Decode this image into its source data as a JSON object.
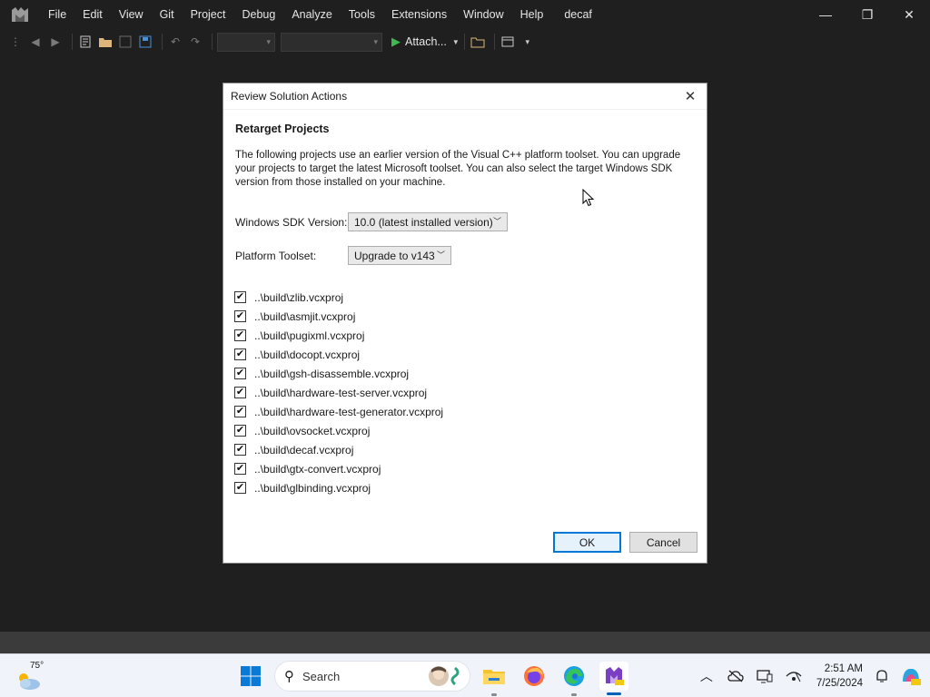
{
  "app": {
    "solution_name": "decaf",
    "menu": [
      "File",
      "Edit",
      "View",
      "Git",
      "Project",
      "Debug",
      "Analyze",
      "Tools",
      "Extensions",
      "Window",
      "Help"
    ],
    "toolbar": {
      "attach_label": "Attach..."
    },
    "window_controls": {
      "minimize": "—",
      "restore": "❐",
      "close": "✕"
    }
  },
  "dialog": {
    "title": "Review Solution Actions",
    "close_glyph": "✕",
    "heading": "Retarget Projects",
    "description": "The following projects use an earlier version of the Visual C++ platform toolset.  You can upgrade your projects to target the latest Microsoft toolset.  You can also select the target Windows SDK version from those installed on your machine.",
    "sdk": {
      "label": "Windows SDK Version:",
      "value": "10.0 (latest installed version)"
    },
    "toolset": {
      "label": "Platform Toolset:",
      "value": "Upgrade to v143"
    },
    "projects": [
      {
        "name": "..\\build\\zlib.vcxproj",
        "checked": true
      },
      {
        "name": "..\\build\\asmjit.vcxproj",
        "checked": true
      },
      {
        "name": "..\\build\\pugixml.vcxproj",
        "checked": true
      },
      {
        "name": "..\\build\\docopt.vcxproj",
        "checked": true
      },
      {
        "name": "..\\build\\gsh-disassemble.vcxproj",
        "checked": true
      },
      {
        "name": "..\\build\\hardware-test-server.vcxproj",
        "checked": true
      },
      {
        "name": "..\\build\\hardware-test-generator.vcxproj",
        "checked": true
      },
      {
        "name": "..\\build\\ovsocket.vcxproj",
        "checked": true
      },
      {
        "name": "..\\build\\decaf.vcxproj",
        "checked": true
      },
      {
        "name": "..\\build\\gtx-convert.vcxproj",
        "checked": true
      },
      {
        "name": "..\\build\\glbinding.vcxproj",
        "checked": true
      }
    ],
    "check_glyph": "✔",
    "ok_label": "OK",
    "cancel_label": "Cancel"
  },
  "taskbar": {
    "weather_temp": "75°",
    "search_placeholder": "Search",
    "time": "2:51 AM",
    "date": "7/25/2024",
    "accent": "#005fb8"
  }
}
